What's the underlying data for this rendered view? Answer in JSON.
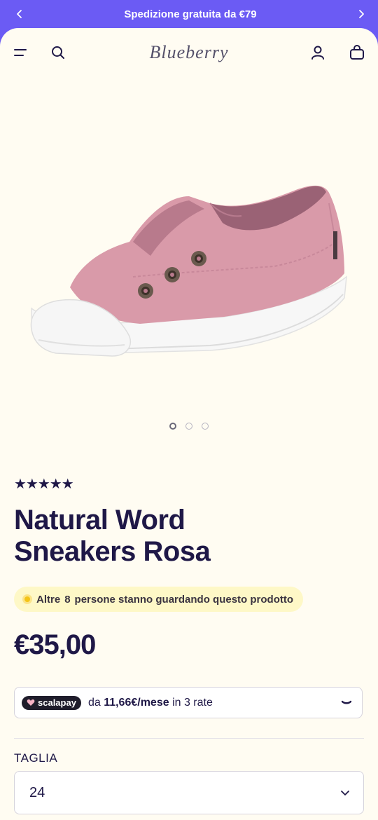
{
  "announcement": {
    "text": "Spedizione gratuita da €79"
  },
  "header": {
    "logo": "Blueberry"
  },
  "gallery": {
    "image_alt": "pink slip-on canvas sneaker",
    "slide_count": 3,
    "active_slide": 1
  },
  "product": {
    "rating_stars": "★★★★★",
    "rating": 5,
    "title_line1": "Natural Word",
    "title_line2": "Sneakers Rosa",
    "viewers_prefix": "Altre",
    "viewers_count": "8",
    "viewers_suffix": "persone stanno guardando questo prodotto",
    "price": "€35,00"
  },
  "scalapay": {
    "badge": "scalapay",
    "prefix": "da",
    "amount": "11,66€/mese",
    "suffix": "in 3 rate"
  },
  "size": {
    "label": "TAGLIA",
    "selected": "24"
  },
  "colors": {
    "brand": "#6b5bf4",
    "background": "#fffcf2",
    "text": "#1f1847",
    "shoe_pink": "#d99aa9",
    "viewers_bg": "#fef8c7"
  }
}
